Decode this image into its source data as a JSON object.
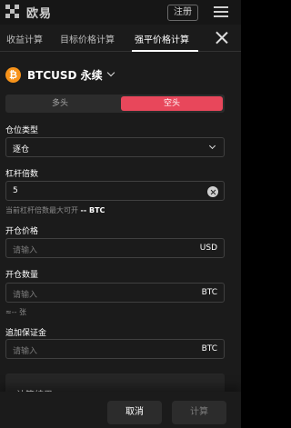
{
  "header": {
    "logo_text": "欧易",
    "register_label": "注册"
  },
  "tabs": [
    {
      "label": "收益计算",
      "active": false
    },
    {
      "label": "目标价格计算",
      "active": false
    },
    {
      "label": "强平价格计算",
      "active": true
    }
  ],
  "pair": {
    "coin_symbol": "₿",
    "label": "BTCUSD 永续"
  },
  "direction": {
    "long_label": "多头",
    "short_label": "空头",
    "selected": "空头"
  },
  "form": {
    "margin_mode_label": "仓位类型",
    "margin_mode_value": "逐仓",
    "leverage_label": "杠杆倍数",
    "leverage_value": "5",
    "leverage_hint_prefix": "当前杠杆倍数最大可开",
    "leverage_hint_value": "-- BTC",
    "open_price_label": "开仓价格",
    "open_price_placeholder": "请输入",
    "open_price_unit": "USD",
    "open_qty_label": "开仓数量",
    "open_qty_placeholder": "请输入",
    "open_qty_unit": "BTC",
    "open_qty_hint": "≈-- 张",
    "add_margin_label": "追加保证金",
    "add_margin_placeholder": "请输入",
    "add_margin_unit": "BTC"
  },
  "result": {
    "title": "计算结果"
  },
  "actions": {
    "cancel_label": "取消",
    "calculate_label": "计算"
  },
  "colors": {
    "short_accent": "#e8475b",
    "coin": "#f7931a",
    "panel_bg": "#1b1b1b"
  }
}
